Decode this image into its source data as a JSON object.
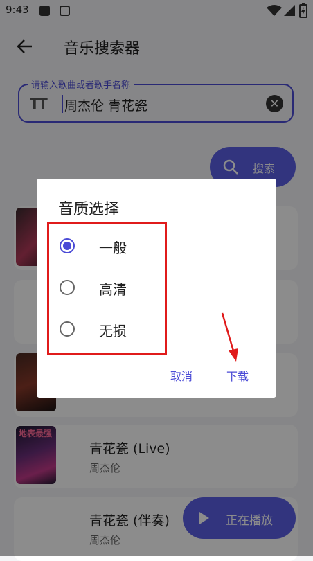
{
  "status_bar": {
    "time": "9:43"
  },
  "app_bar": {
    "title": "音乐搜索器"
  },
  "search": {
    "label": "请输入歌曲或者歌手名称",
    "value": "周杰伦 青花瓷",
    "button_label": "搜索"
  },
  "results": [
    {
      "song": "",
      "artist": ""
    },
    {
      "song": "",
      "artist": ""
    },
    {
      "song": "",
      "artist": ""
    },
    {
      "song": "青花瓷 (Live)",
      "artist": "周杰伦",
      "cover_text": "地表最强"
    },
    {
      "song": "青花瓷 (伴奏)",
      "artist": "周杰伦"
    }
  ],
  "fab": {
    "label": "正在播放"
  },
  "dialog": {
    "title": "音质选择",
    "options": [
      {
        "label": "一般",
        "selected": true
      },
      {
        "label": "高清",
        "selected": false
      },
      {
        "label": "无损",
        "selected": false
      }
    ],
    "cancel_label": "取消",
    "download_label": "下载"
  },
  "colors": {
    "accent": "#5b5fe6",
    "annotation": "#e01b1b"
  }
}
